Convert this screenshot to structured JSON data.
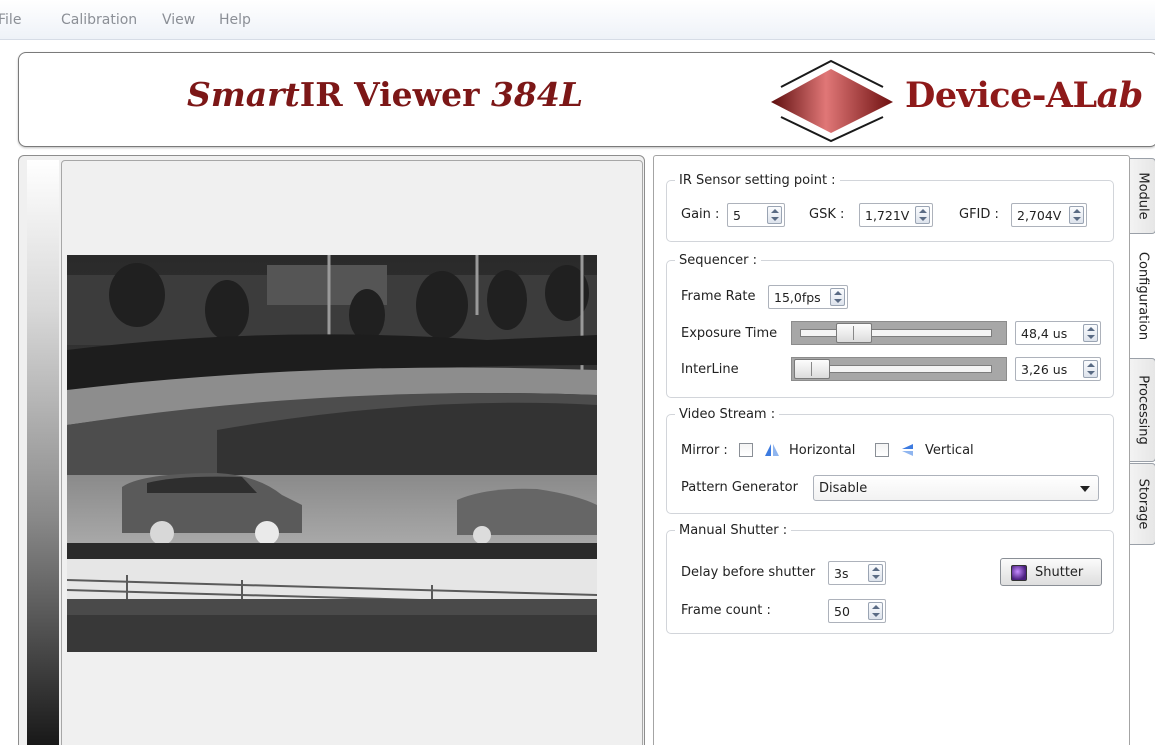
{
  "menu": [
    "File",
    "Calibration",
    "View",
    "Help"
  ],
  "banner": {
    "title_prefix": "Smart",
    "title_main": "IR Viewer ",
    "title_model": "384L",
    "logo_text_main": "Device-AL",
    "logo_text_italic": "ab"
  },
  "tabs": [
    "Module",
    "Configuration",
    "Processing",
    "Storage"
  ],
  "ir_sensor": {
    "title": "IR Sensor setting point :",
    "gain_label": "Gain :",
    "gain_value": "5",
    "gsk_label": "GSK :",
    "gsk_value": "1,721V",
    "gfid_label": "GFID :",
    "gfid_value": "2,704V"
  },
  "sequencer": {
    "title": "Sequencer :",
    "frame_rate_label": "Frame Rate",
    "frame_rate_value": "15,0fps",
    "exposure_label": "Exposure Time",
    "exposure_value": "48,4 us",
    "exposure_level": 0.2,
    "interline_label": "InterLine",
    "interline_value": "3,26 us",
    "interline_level": 0.02
  },
  "video_stream": {
    "title": "Video Stream :",
    "mirror_label": "Mirror :",
    "horizontal_label": "Horizontal",
    "horizontal_checked": false,
    "vertical_label": "Vertical",
    "vertical_checked": false,
    "pattern_label": "Pattern Generator",
    "pattern_value": "Disable"
  },
  "manual_shutter": {
    "title": "Manual Shutter :",
    "delay_label": "Delay before shutter",
    "delay_value": "3s",
    "frame_count_label": "Frame count :",
    "frame_count_value": "50",
    "shutter_button": "Shutter"
  },
  "colors": {
    "brand_red": "#7c1717",
    "menu_text": "#8b8f96"
  }
}
